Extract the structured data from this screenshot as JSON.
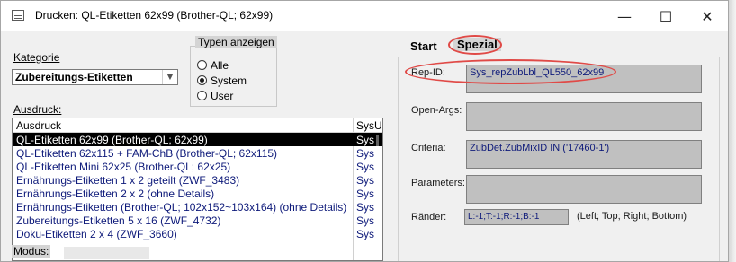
{
  "window": {
    "title": "Drucken: QL-Etiketten 62x99 (Brother-QL; 62x99)",
    "minimize_glyph": "—",
    "maximize_glyph": "☐",
    "close_glyph": "✕"
  },
  "left": {
    "kategorie_label": "Kategorie",
    "kategorie_value": "Zubereitungs-Etiketten",
    "typen_label": "Typen anzeigen",
    "radios": [
      {
        "label": "Alle",
        "selected": false
      },
      {
        "label": "System",
        "selected": true
      },
      {
        "label": "User",
        "selected": false
      }
    ],
    "ausdruck_label": "Ausdruck:",
    "list_headers": [
      "Ausdruck",
      "SysU"
    ],
    "list_rows": [
      {
        "name": "QL-Etiketten 62x99 (Brother-QL; 62x99)",
        "type": "Sys",
        "selected": true
      },
      {
        "name": "QL-Etiketten 62x115 + FAM-ChB (Brother-QL; 62x115)",
        "type": "Sys",
        "selected": false
      },
      {
        "name": "QL-Etiketten Mini 62x25 (Brother-QL; 62x25)",
        "type": "Sys",
        "selected": false
      },
      {
        "name": "Ernährungs-Etiketten 1 x 2 geteilt (ZWF_3483)",
        "type": "Sys",
        "selected": false
      },
      {
        "name": "Ernährungs-Etiketten 2 x 2 (ohne Details)",
        "type": "Sys",
        "selected": false
      },
      {
        "name": "Ernährungs-Etiketten (Brother-QL; 102x152~103x164) (ohne Details)",
        "type": "Sys",
        "selected": false
      },
      {
        "name": "Zubereitungs-Etiketten 5 x 16 (ZWF_4732)",
        "type": "Sys",
        "selected": false
      },
      {
        "name": "Doku-Etiketten 2 x 4 (ZWF_3660)",
        "type": "Sys",
        "selected": false
      }
    ],
    "modus_label": "Modus:"
  },
  "right": {
    "tab_start": "Start",
    "tab_spezial": "Spezial",
    "rep_id_label": "Rep-ID:",
    "rep_id_value": "Sys_repZubLbl_QL550_62x99",
    "open_args_label": "Open-Args:",
    "open_args_value": "",
    "criteria_label": "Criteria:",
    "criteria_value": "ZubDet.ZubMixID IN ('17460-1')",
    "parameters_label": "Parameters:",
    "parameters_value": "",
    "raender_label": "Ränder:",
    "raender_value": "L:-1;T:-1;R:-1;B:-1",
    "raender_hint": "(Left; Top; Right; Bottom)"
  },
  "colors": {
    "annotation": "#e04a47",
    "list_text": "#0e1a7a",
    "field_bg": "#c0c0c0"
  }
}
